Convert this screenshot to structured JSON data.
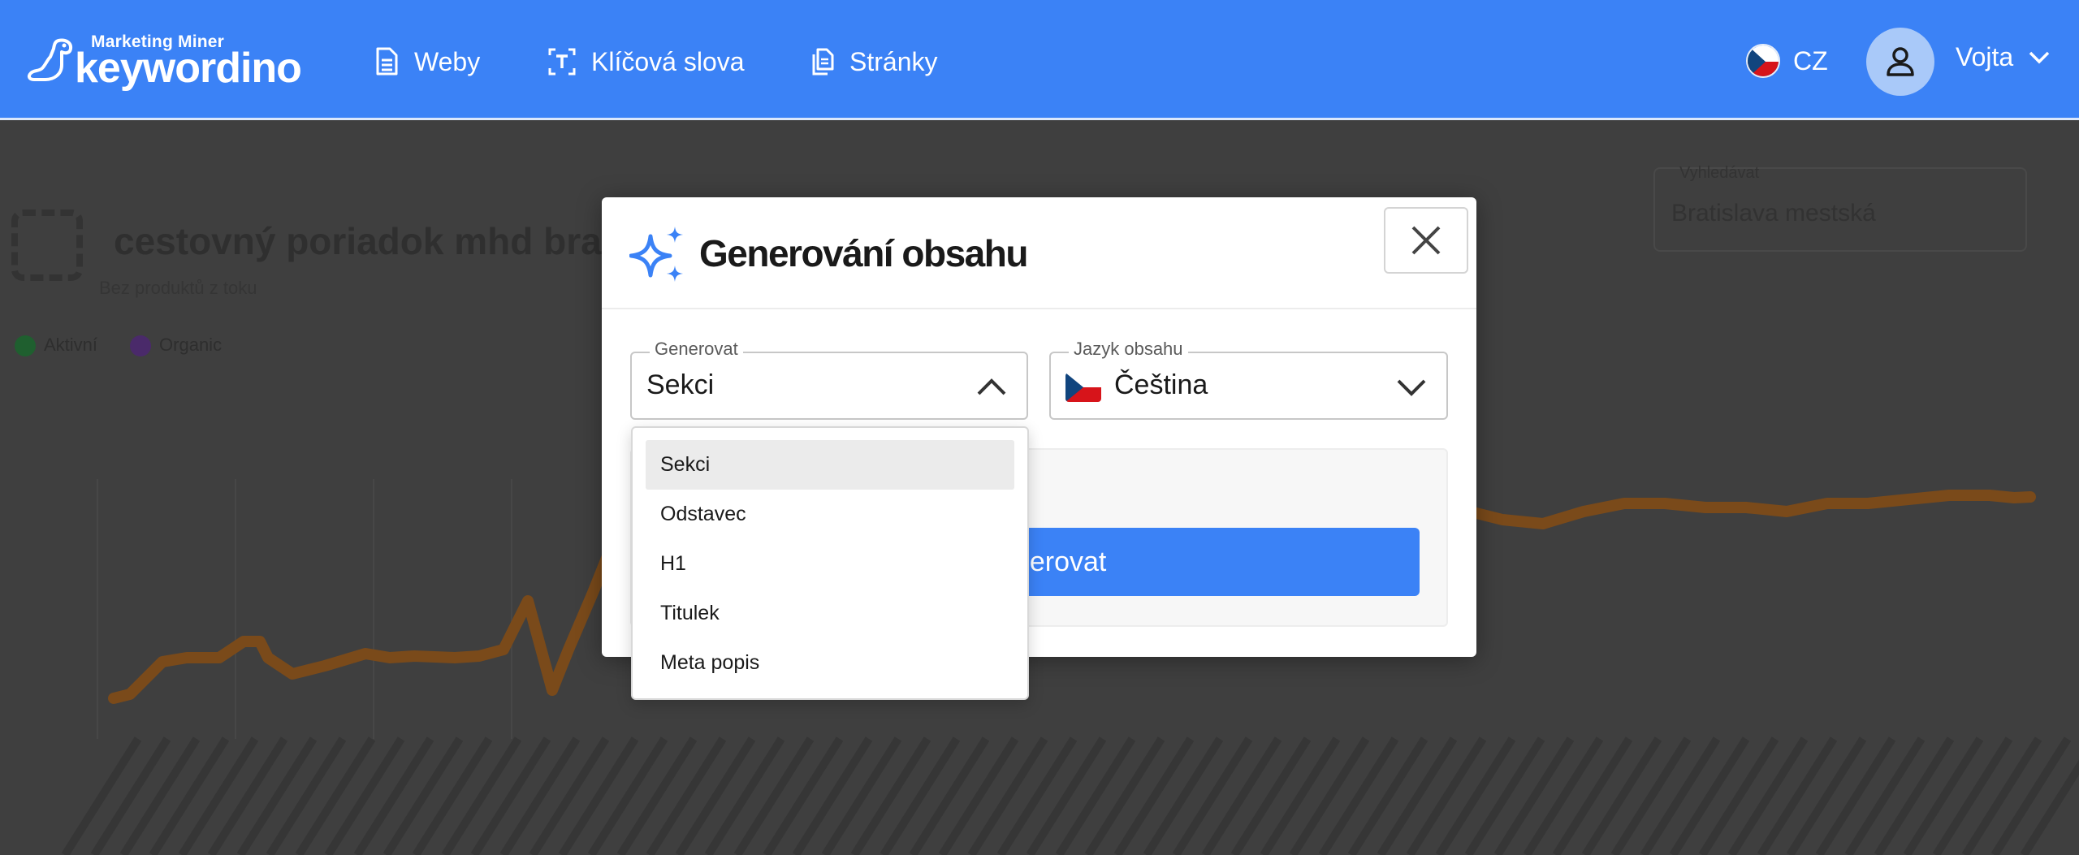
{
  "header": {
    "logo_small": "Marketing Miner",
    "logo_big": "keywordino",
    "nav": [
      {
        "label": "Weby",
        "icon": "document-icon"
      },
      {
        "label": "Klíčová slova",
        "icon": "text-tool-icon"
      },
      {
        "label": "Stránky",
        "icon": "pages-icon"
      }
    ],
    "language": "CZ",
    "user_name": "Vojta"
  },
  "background": {
    "title": "cestovný poriadok mhd bra",
    "subtitle": "Bez produktů z toku",
    "legend": [
      "Aktivní",
      "Organic"
    ],
    "box_label": "Vyhledávat",
    "box_value": "Bratislava mestská",
    "colors": {
      "series": "#7a4a1a",
      "legend1": "#1f5f2f",
      "legend2": "#4a2a6a"
    }
  },
  "modal": {
    "title": "Generování obsahu",
    "generate_field": {
      "label": "Generovat",
      "value": "Sekci"
    },
    "language_field": {
      "label": "Jazyk obsahu",
      "value": "Čeština"
    },
    "submit_label": "Generovat"
  },
  "dropdown": {
    "options": [
      "Sekci",
      "Odstavec",
      "H1",
      "Titulek",
      "Meta popis"
    ],
    "selected": "Sekci"
  },
  "colors": {
    "accent": "#3b82f6",
    "overlay": "#3f3f3f"
  }
}
